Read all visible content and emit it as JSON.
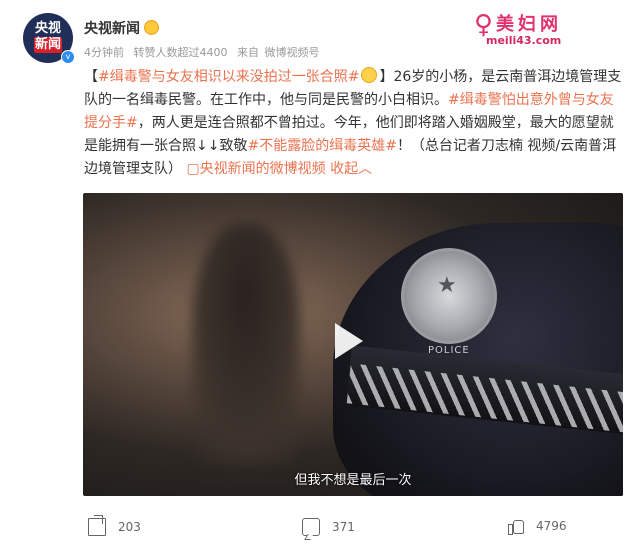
{
  "author": {
    "name": "央视新闻",
    "avatar_text_1": "央视",
    "avatar_text_2": "新闻"
  },
  "meta": {
    "time": "4分钟前",
    "reposts": "转赞人数超过4400",
    "source_prefix": "来自",
    "source": "微博视频号"
  },
  "watermark": {
    "logo": "♀",
    "text": "美妇网",
    "url": "meili43.com"
  },
  "post": {
    "open_bracket": "【",
    "title_tag": "#缉毒警与女友相识以来没拍过一张合照#",
    "close_bracket": "】",
    "text1": "26岁的小杨，是云南普洱边境管理支队的一名缉毒民警。在工作中，他与同是民警的小白相识。",
    "tag2": "#缉毒警怕出意外曾与女友提分手#",
    "text2": "，两人更是连合照都不曾拍过。今年，他们即将踏入婚姻殿堂，最大的愿望就是能拥有一张合照↓↓致敬",
    "tag3": "#不能露脸的缉毒英雄#",
    "text3": "！（总台记者刀志楠 视频/云南普洱边境管理支队）",
    "video_link": "▢央视新闻的微博视频",
    "collapse": "收起",
    "collapse_icon": "︿"
  },
  "video": {
    "subtitle": "但我不想是最后一次",
    "police_label": "POLICE"
  },
  "actions": {
    "share_count": "203",
    "comment_count": "371",
    "like_count": "4796"
  }
}
